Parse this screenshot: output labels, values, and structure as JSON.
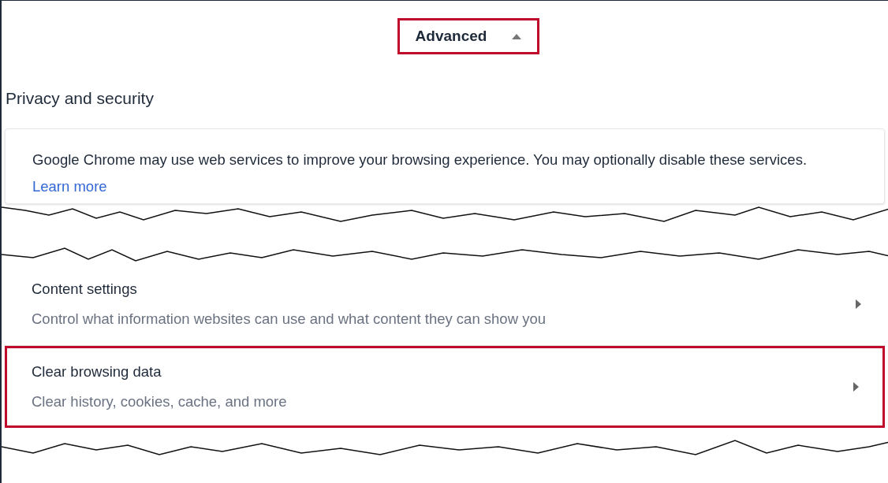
{
  "advanced_toggle": {
    "label": "Advanced",
    "expanded": true,
    "highlighted": true
  },
  "section_title": "Privacy and security",
  "intro": {
    "text": "Google Chrome may use web services to improve your browsing experience. You may optionally disable these services.",
    "link": "Learn more"
  },
  "rows": [
    {
      "title": "Content settings",
      "subtitle": "Control what information websites can use and what content they can show you",
      "highlighted": false
    },
    {
      "title": "Clear browsing data",
      "subtitle": "Clear history, cookies, cache, and more",
      "highlighted": true
    }
  ]
}
